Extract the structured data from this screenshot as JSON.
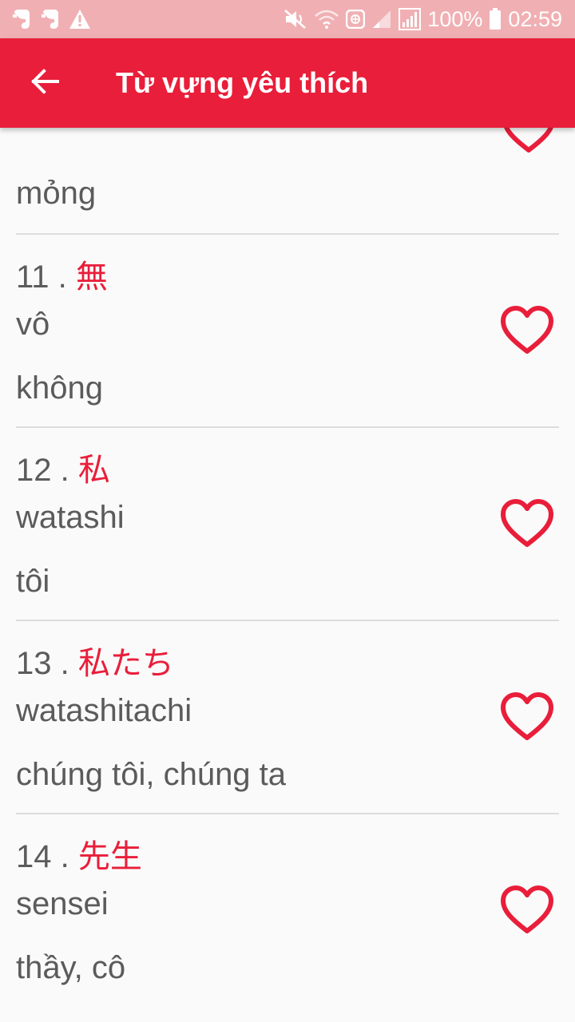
{
  "status_bar": {
    "left_icons": [
      "evernote-icon",
      "evernote-icon",
      "warning-icon"
    ],
    "battery": "100%",
    "time": "02:59"
  },
  "app_bar": {
    "title": "Từ vựng yêu thích",
    "back_icon": "arrow-back-icon"
  },
  "list": {
    "partial_item": {
      "meaning": "mỏng"
    },
    "items": [
      {
        "number": "11",
        "separator": " . ",
        "kanji": "無",
        "reading": "vô",
        "meaning": "không"
      },
      {
        "number": "12",
        "separator": " . ",
        "kanji": "私",
        "reading": "watashi",
        "meaning": "tôi"
      },
      {
        "number": "13",
        "separator": " . ",
        "kanji": "私たち",
        "reading": "watashitachi",
        "meaning": "chúng tôi, chúng ta"
      },
      {
        "number": "14",
        "separator": " . ",
        "kanji": "先生",
        "reading": "sensei",
        "meaning": "thầy, cô"
      }
    ]
  },
  "colors": {
    "accent": "#e91e3a",
    "status_bar": "#f0b0b3",
    "text": "#5b5b5b",
    "divider": "#dddddd",
    "background": "#fafafa"
  }
}
